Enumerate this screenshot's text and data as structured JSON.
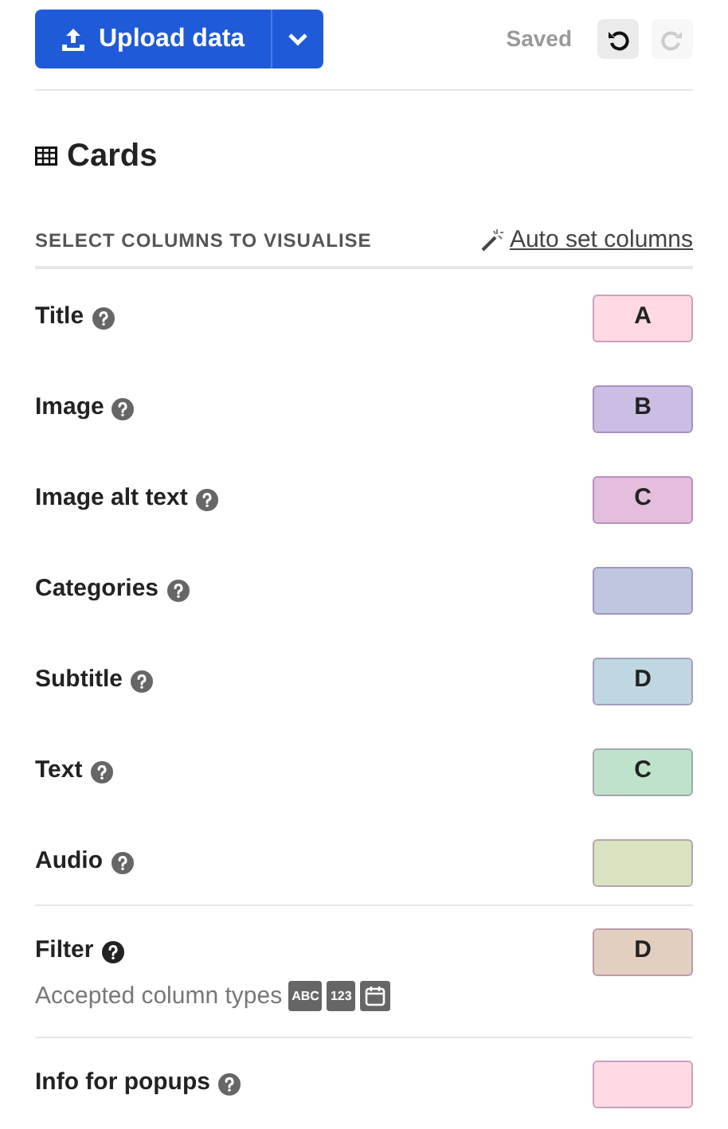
{
  "toolbar": {
    "upload_button": "Upload data",
    "status": "Saved",
    "undo_disabled": false,
    "redo_disabled": true
  },
  "section": {
    "title": "Cards",
    "subheading": "SELECT COLUMNS TO VISUALISE",
    "auto_link": "Auto set columns"
  },
  "fields": [
    {
      "label": "Title",
      "column": "A",
      "color": "#ffd9e3"
    },
    {
      "label": "Image",
      "column": "B",
      "color": "#cbbde3"
    },
    {
      "label": "Image alt text",
      "column": "C",
      "color": "#e3bfdd"
    },
    {
      "label": "Categories",
      "color": "#bfc6e0"
    },
    {
      "label": "Subtitle",
      "column": "D",
      "color": "#bfd7e0"
    },
    {
      "label": "Text",
      "column": "C",
      "color": "#bfe3ca"
    },
    {
      "label": "Audio",
      "color": "#d9e3bf"
    },
    {
      "label": "Filter",
      "column": "D",
      "color": "#e3cfbf",
      "divided": true,
      "note": "Accepted column types",
      "types": [
        {
          "kind": "text",
          "label": "ABC"
        },
        {
          "kind": "text",
          "label": "123"
        },
        {
          "kind": "date"
        }
      ]
    },
    {
      "label": "Info for popups",
      "color": "#ffd9e3",
      "divided": true
    }
  ]
}
